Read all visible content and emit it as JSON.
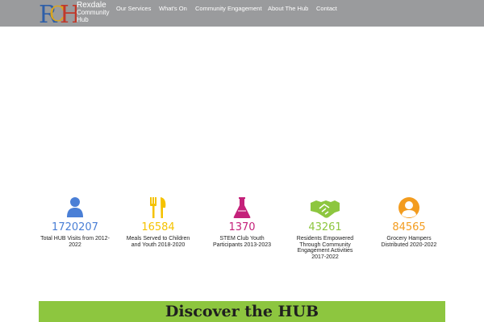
{
  "header": {
    "logo": {
      "line1": "Rexdale",
      "line2": "Community",
      "line3": "Hub",
      "mark_text": "RCH"
    },
    "nav": [
      {
        "label": "Our Services",
        "icon": "none"
      },
      {
        "label": "What's On",
        "icon": "none"
      },
      {
        "label": "Community Engagement",
        "icon": "none"
      },
      {
        "label": "About The Hub",
        "icon": "none"
      },
      {
        "label": "Contact",
        "icon": "none"
      }
    ],
    "background": "#9a9b9d"
  },
  "stats": [
    {
      "icon": "user-icon",
      "number": "1720207",
      "label": "Total HUB Visits from 2012-2022",
      "color": "#4a7fd6"
    },
    {
      "icon": "cutlery-icon",
      "number": "16584",
      "label": "Meals Served to Children and Youth 2018-2020",
      "color": "#f5c200"
    },
    {
      "icon": "flask-icon",
      "number": "1370",
      "label": "STEM Club Youth Participants 2013-2023",
      "color": "#c4217a"
    },
    {
      "icon": "handshake-icon",
      "number": "43261",
      "label": "Residents Empowered Through Community Engagement Activities 2017-2022",
      "color": "#8dc63f"
    },
    {
      "icon": "person-circle-icon",
      "number": "84565",
      "label": "Grocery Hampers Distributed 2020-2022",
      "color": "#f39c1f"
    }
  ],
  "discover": {
    "title": "Discover the HUB",
    "background": "#8dc63f"
  }
}
